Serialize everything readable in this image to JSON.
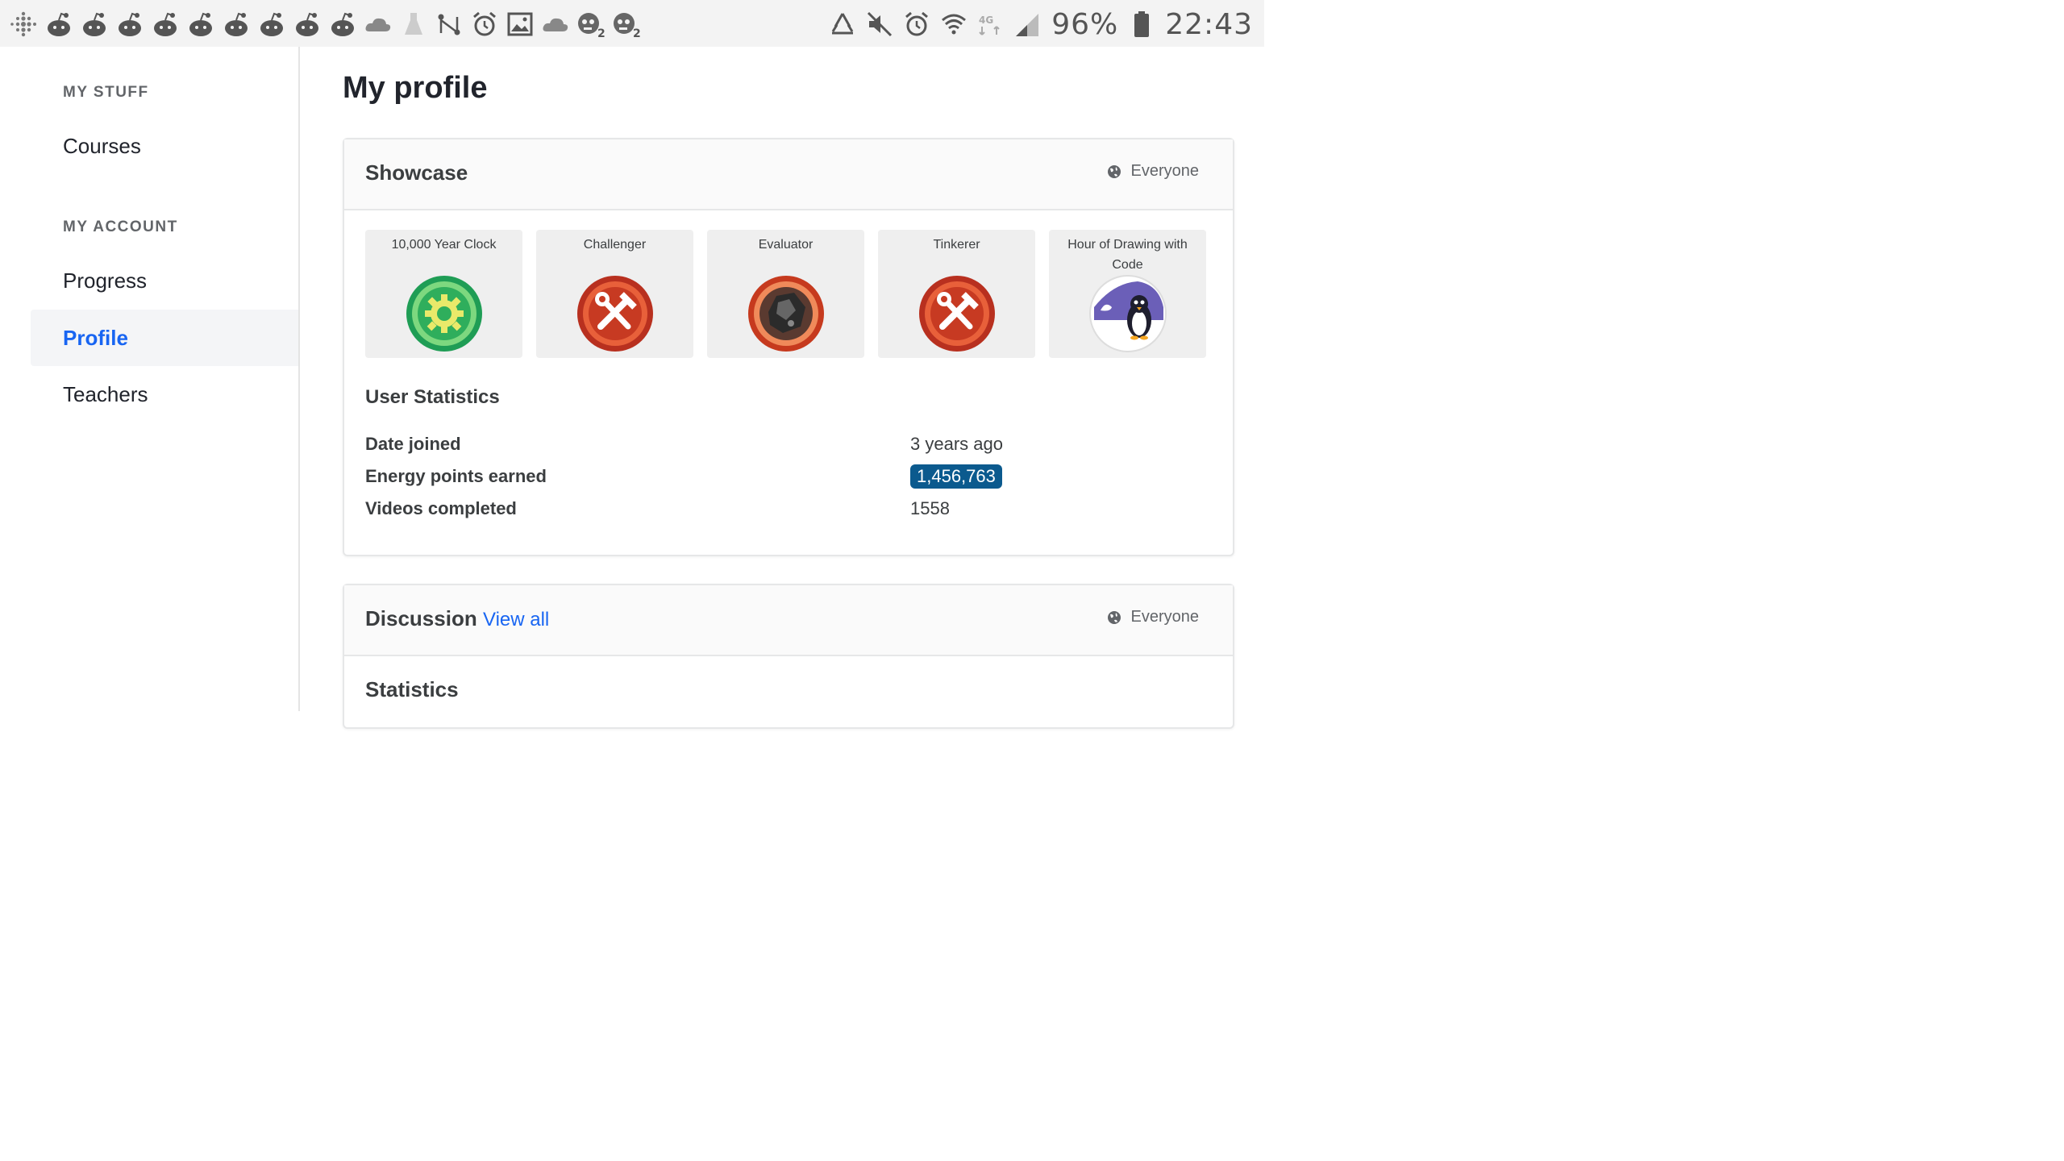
{
  "status_bar": {
    "left_icons": [
      "fitbit-icon",
      "reddit-icon",
      "reddit-icon",
      "reddit-icon",
      "reddit-icon",
      "reddit-icon",
      "reddit-icon",
      "reddit-icon",
      "reddit-icon",
      "reddit-icon",
      "cloud-icon",
      "flask-icon",
      "route-icon",
      "alarm-icon",
      "image-icon",
      "cloud-icon",
      "zombie-icon",
      "zombie-icon"
    ],
    "battery": "96%",
    "time": "22:43"
  },
  "sidebar": {
    "section_my_stuff": "MY STUFF",
    "courses": "Courses",
    "section_my_account": "MY ACCOUNT",
    "progress": "Progress",
    "profile": "Profile",
    "teachers": "Teachers"
  },
  "main": {
    "title": "My profile",
    "showcase": {
      "title": "Showcase",
      "visibility": "Everyone",
      "badges": [
        {
          "name": "10,000 Year Clock",
          "icon": "gear-badge-icon"
        },
        {
          "name": "Challenger",
          "icon": "tools-badge-icon"
        },
        {
          "name": "Evaluator",
          "icon": "meteorite-badge-icon"
        },
        {
          "name": "Tinkerer",
          "icon": "tools-badge-icon"
        },
        {
          "name": "Hour of Drawing with Code",
          "icon": "penguin-badge-icon"
        }
      ],
      "user_statistics": {
        "title": "User Statistics",
        "rows": [
          {
            "label": "Date joined",
            "value": "3 years ago"
          },
          {
            "label": "Energy points earned",
            "value": "1,456,763"
          },
          {
            "label": "Videos completed",
            "value": "1558"
          }
        ]
      }
    },
    "discussion": {
      "title": "Discussion",
      "view_all": "View all",
      "visibility": "Everyone",
      "statistics_title": "Statistics"
    }
  },
  "colors": {
    "accent": "#1865f2",
    "energy_badge": "#0b5a8e"
  }
}
